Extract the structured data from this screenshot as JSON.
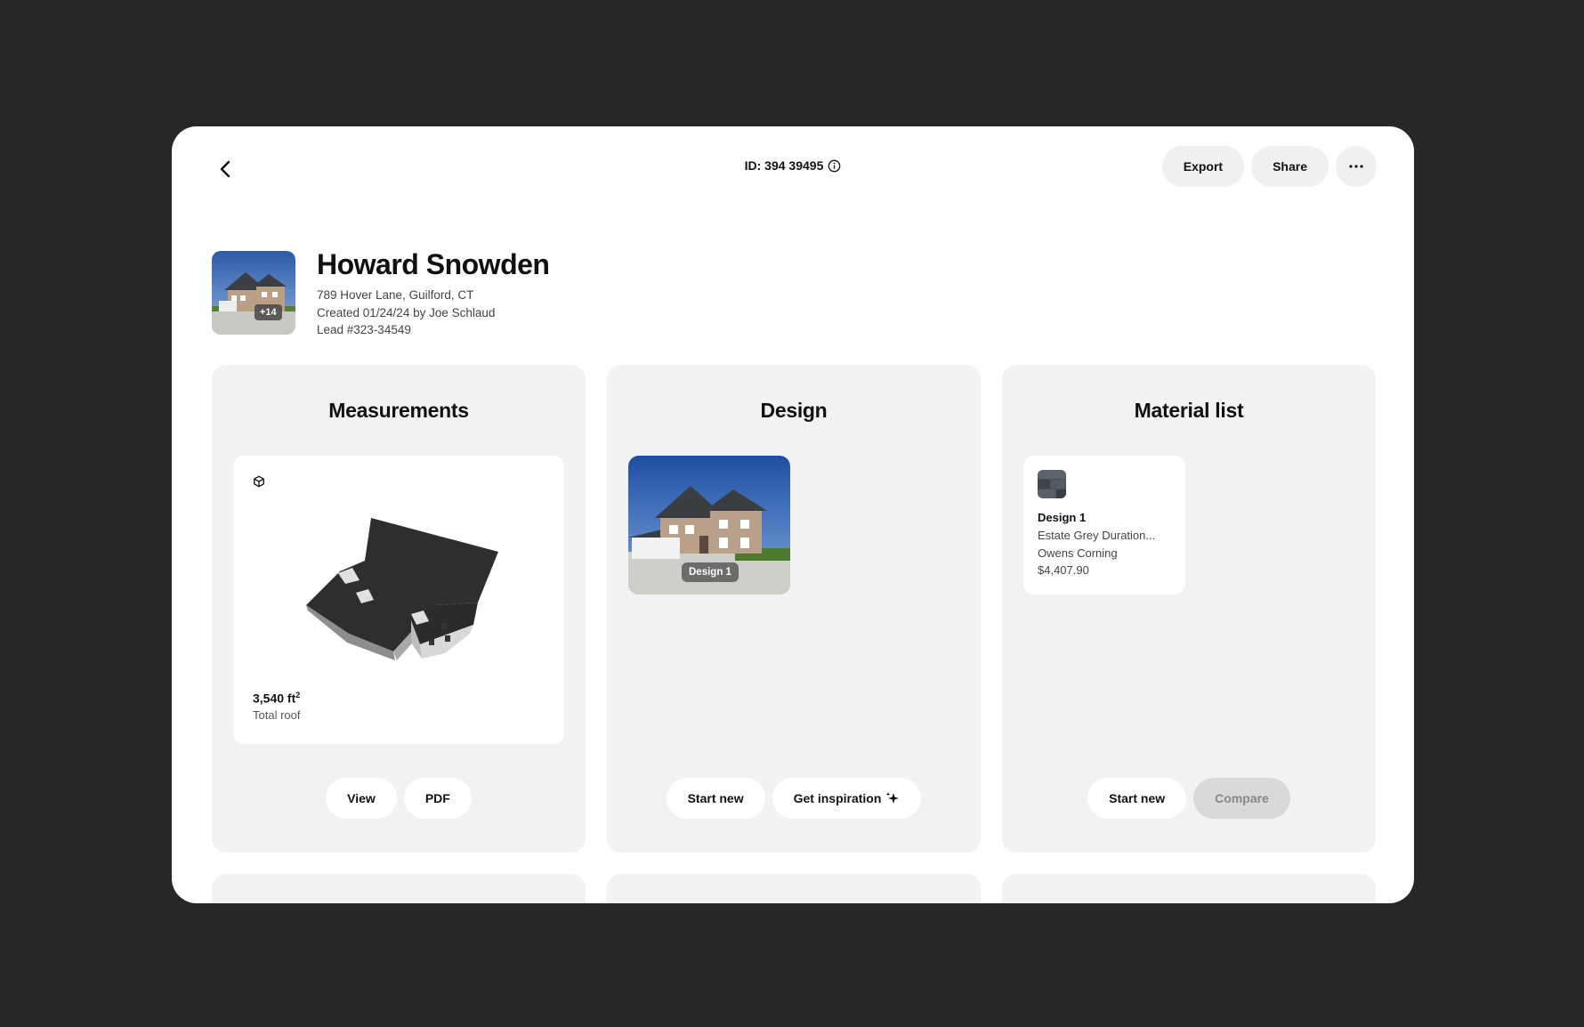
{
  "topbar": {
    "id_label": "ID: 394 39495",
    "export_label": "Export",
    "share_label": "Share"
  },
  "header": {
    "name": "Howard Snowden",
    "address": "789 Hover Lane, Guilford, CT",
    "created": "Created 01/24/24 by Joe Schlaud",
    "lead": "Lead #323-34549",
    "photo_count": "+14"
  },
  "measurements": {
    "title": "Measurements",
    "area_value": "3,540 ft",
    "area_unit_sup": "2",
    "area_label": "Total roof",
    "view_label": "View",
    "pdf_label": "PDF"
  },
  "design": {
    "title": "Design",
    "thumb_label": "Design 1",
    "start_new_label": "Start new",
    "inspiration_label": "Get inspiration"
  },
  "material": {
    "title": "Material list",
    "item_title": "Design 1",
    "item_product": "Estate Grey Duration...",
    "item_brand": "Owens Corning",
    "item_price": "$4,407.90",
    "start_new_label": "Start new",
    "compare_label": "Compare"
  },
  "colors": {
    "frame": "#262826",
    "card_bg": "#f2f2f2",
    "pill_bg": "#f0f0f0",
    "disabled_bg": "#d9d9d9"
  },
  "icons": {
    "back": "chevron-left-icon",
    "info": "info-icon",
    "more": "ellipsis-icon",
    "model": "cube-icon",
    "sparkle": "sparkle-icon"
  }
}
